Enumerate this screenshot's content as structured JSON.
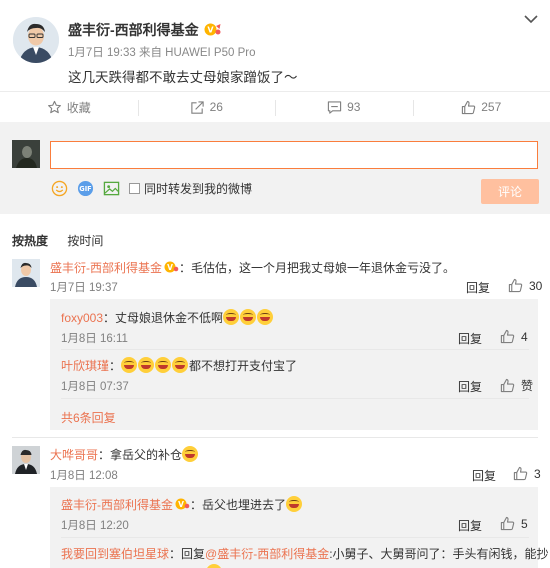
{
  "post": {
    "author": "盛丰衍-西部利得基金",
    "meta": "1月7日 19:33 来自 HUAWEI P50 Pro",
    "text": "这几天跌得都不敢去丈母娘家蹭饭了～"
  },
  "actions": [
    {
      "icon": "star-icon",
      "label": "收藏"
    },
    {
      "icon": "share-icon",
      "label": "26"
    },
    {
      "icon": "comment-icon",
      "label": "93"
    },
    {
      "icon": "thumbs-up-icon",
      "label": "257"
    }
  ],
  "composer": {
    "input_value": "",
    "repost_label": "同时转发到我的微博",
    "submit_label": "评论"
  },
  "sort": {
    "hot": "按热度",
    "time": "按时间"
  },
  "comments": [
    {
      "user": "盛丰衍-西部利得基金",
      "text": "：毛估估，这一个月把我丈母娘一年退休金亏没了。",
      "date": "1月7日 19:37",
      "reply": "回复",
      "likes": "30",
      "subs": [
        {
          "user": "foxy003",
          "text": "：丈母娘退休金不低啊",
          "date": "1月8日 16:11",
          "reply": "回复",
          "likes": "4"
        },
        {
          "user": "叶欣琪瑾",
          "text": "都不想打开支付宝了",
          "date": "1月8日 07:37",
          "reply": "回复",
          "likes": "赞"
        }
      ],
      "more": "共6条回复"
    },
    {
      "user": "大哗哥哥",
      "text": "：拿岳父的补仓",
      "date": "1月8日 12:08",
      "reply": "回复",
      "likes": "3",
      "subs": [
        {
          "user": "盛丰衍-西部利得基金",
          "text": "：岳父也埋进去了",
          "date": "1月8日 12:20",
          "reply": "回复",
          "likes": "5"
        },
        {
          "user": "我要回到塞伯坦星球",
          "text": "：回复",
          "mention": "@盛丰衍-西部利得基金",
          "text2": ":小舅子、大舅哥问了：手头有闲钱，能抄"
        }
      ]
    }
  ],
  "colors": {
    "accent": "#fa7d3c",
    "link": "#eb7350",
    "submit": "#ffc09f"
  }
}
